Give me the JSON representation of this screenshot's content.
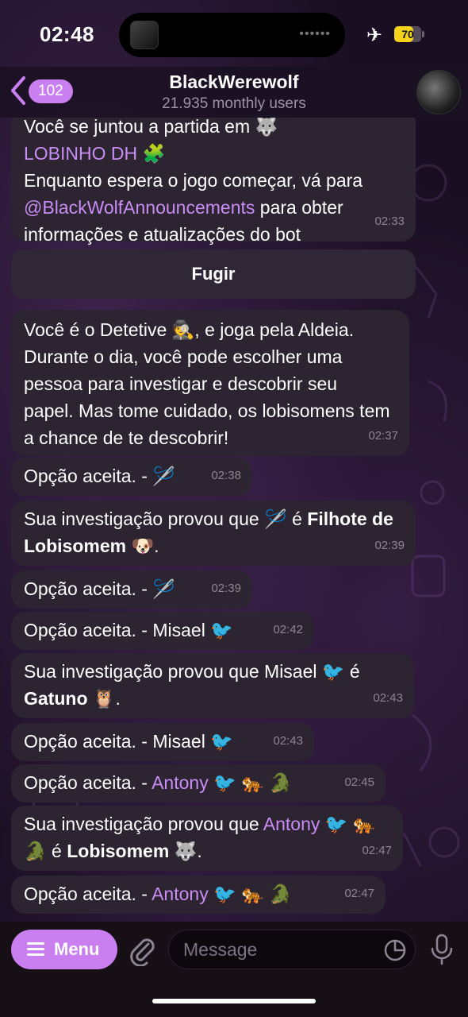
{
  "status_bar": {
    "time": "02:48",
    "island_dots": "••••••",
    "battery_level": 70,
    "battery_text": "70"
  },
  "header": {
    "back_count": "102",
    "title": "BlackWerewolf",
    "subtitle": "21.935 monthly users"
  },
  "messages": [
    {
      "top_line": "Você se juntou a partida em 🐺",
      "game_name": "LOBINHO DH 🧩",
      "line3": "Enquanto espera o jogo começar, vá para",
      "link": "@BlackWolfAnnouncements",
      "line4_rest": " para obter",
      "line5": "informações e atualizações do bot",
      "time": "02:33"
    },
    {
      "text": "Você é o Detetive 🕵️, e joga pela Aldeia. Durante o dia, você pode escolher uma pessoa para investigar e descobrir seu papel. Mas tome cuidado, os lobisomens tem a chance de te descobrir!",
      "time": "02:37"
    },
    {
      "text": "Opção aceita. - 🪡",
      "time": "02:38"
    },
    {
      "pre": "Sua investigação provou que 🪡 é ",
      "bold": "Filhote de Lobisomem",
      "post": " 🐶.",
      "time": "02:39"
    },
    {
      "text": "Opção aceita. - 🪡",
      "time": "02:39"
    },
    {
      "text": "Opção aceita. - Misael 🐦",
      "time": "02:42"
    },
    {
      "pre": "Sua investigação provou que Misael 🐦 é ",
      "bold": "Gatuno",
      "post": " 🦉.",
      "time": "02:43"
    },
    {
      "text": "Opção aceita. - Misael 🐦",
      "time": "02:43"
    },
    {
      "pre": "Opção aceita. - ",
      "name": "Antony",
      "post": " 🐦 🐅 🐊",
      "time": "02:45"
    },
    {
      "pre": "Sua investigação provou que ",
      "name": "Antony",
      "mid": " 🐦 🐅 🐊 é ",
      "bold": "Lobisomem",
      "post": " 🐺.",
      "time": "02:47"
    },
    {
      "pre": "Opção aceita. - ",
      "name": "Antony",
      "post": " 🐦 🐅 🐊",
      "time": "02:47"
    }
  ],
  "inline_button": {
    "label": "Fugir"
  },
  "input": {
    "menu_label": "Menu",
    "placeholder": "Message"
  },
  "colors": {
    "accent": "#c97ff0",
    "bubble": "#2c2431",
    "link": "#c98cf4"
  }
}
